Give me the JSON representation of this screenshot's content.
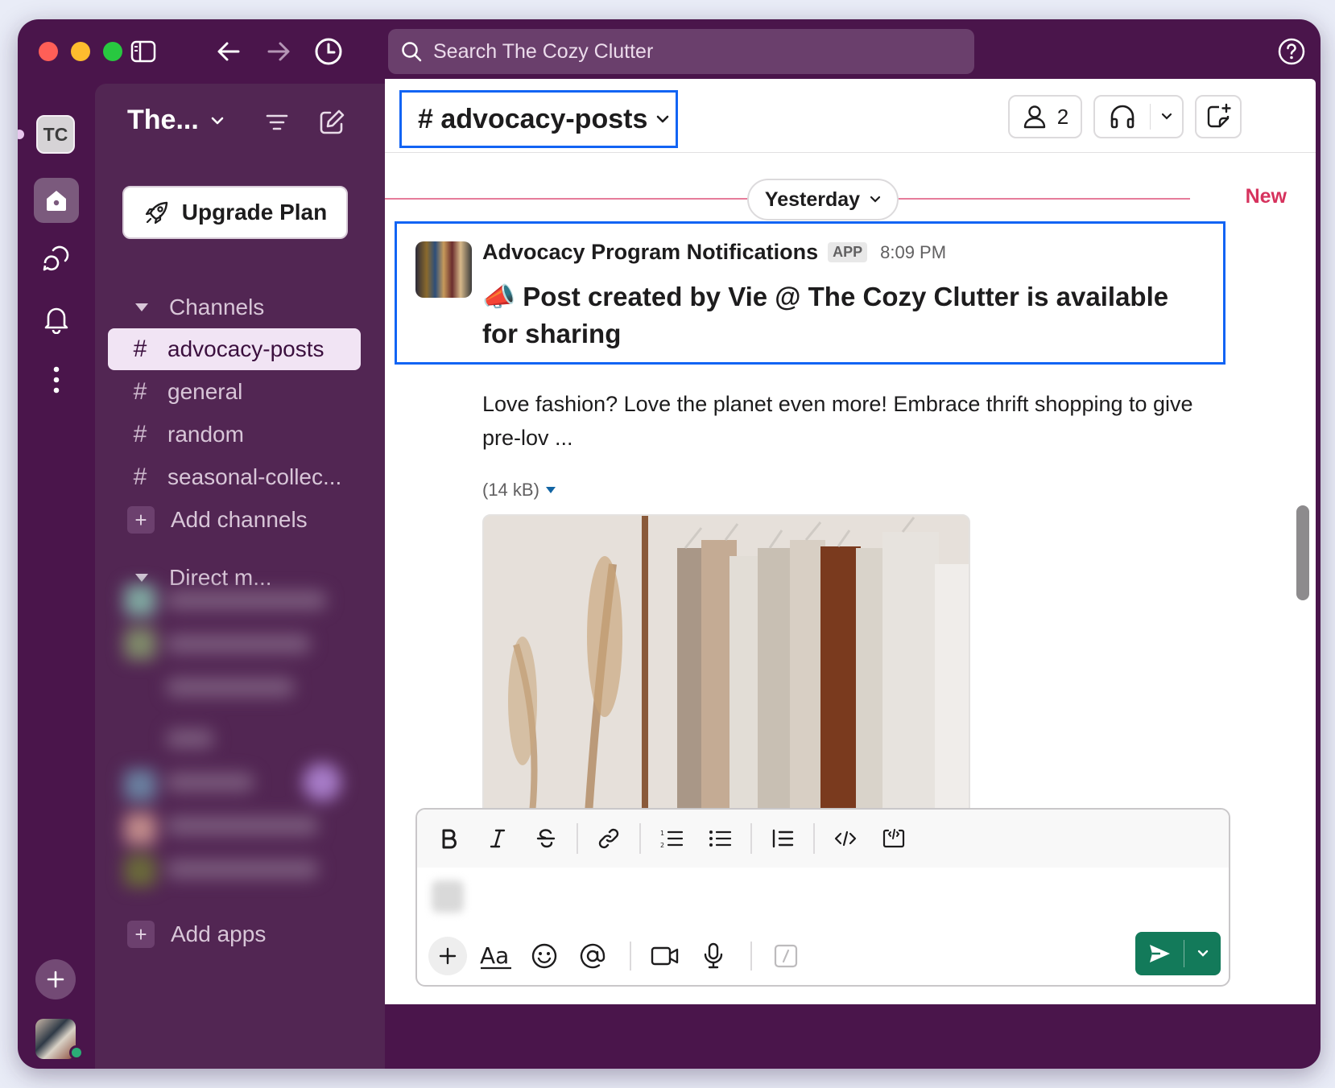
{
  "search": {
    "placeholder": "Search The Cozy Clutter"
  },
  "rail": {
    "workspace_initials": "TC"
  },
  "sidebar": {
    "workspace_name": "The...",
    "upgrade_label": "Upgrade Plan",
    "channels_header": "Channels",
    "channels": [
      {
        "name": "advocacy-posts",
        "active": true
      },
      {
        "name": "general",
        "active": false
      },
      {
        "name": "random",
        "active": false
      },
      {
        "name": "seasonal-collec...",
        "active": false
      }
    ],
    "add_channels_label": "Add channels",
    "direct_messages_header": "Direct m...",
    "add_apps_label": "Add apps"
  },
  "channel_header": {
    "title": "# advocacy-posts",
    "member_count": "2"
  },
  "timeline": {
    "date_label": "Yesterday",
    "new_label": "New"
  },
  "message": {
    "author": "Advocacy Program Notifications",
    "badge": "APP",
    "time": "8:09 PM",
    "headline_emoji": "📣",
    "headline": "Post created by Vie @ The Cozy Clutter is available for sharing",
    "body": "Love fashion? Love the planet even more! Embrace thrift shopping to give pre-lov ...",
    "file_size": "(14 kB)"
  },
  "composer": {
    "format_buttons": [
      "bold-icon",
      "italic-icon",
      "strikethrough-icon",
      "link-icon",
      "ordered-list-icon",
      "bullet-list-icon",
      "blockquote-icon",
      "code-icon",
      "code-block-icon"
    ],
    "bottom_buttons": [
      "plus-icon",
      "formatting-icon",
      "emoji-icon",
      "mention-icon",
      "video-icon",
      "microphone-icon",
      "slash-command-icon"
    ]
  },
  "colors": {
    "aubergine": "#4a154b",
    "sidebar": "#522653",
    "active_channel_bg": "#f1e4f4",
    "highlight_border": "#1264f4",
    "new_divider": "#d6325d",
    "send_green": "#137a5a"
  }
}
